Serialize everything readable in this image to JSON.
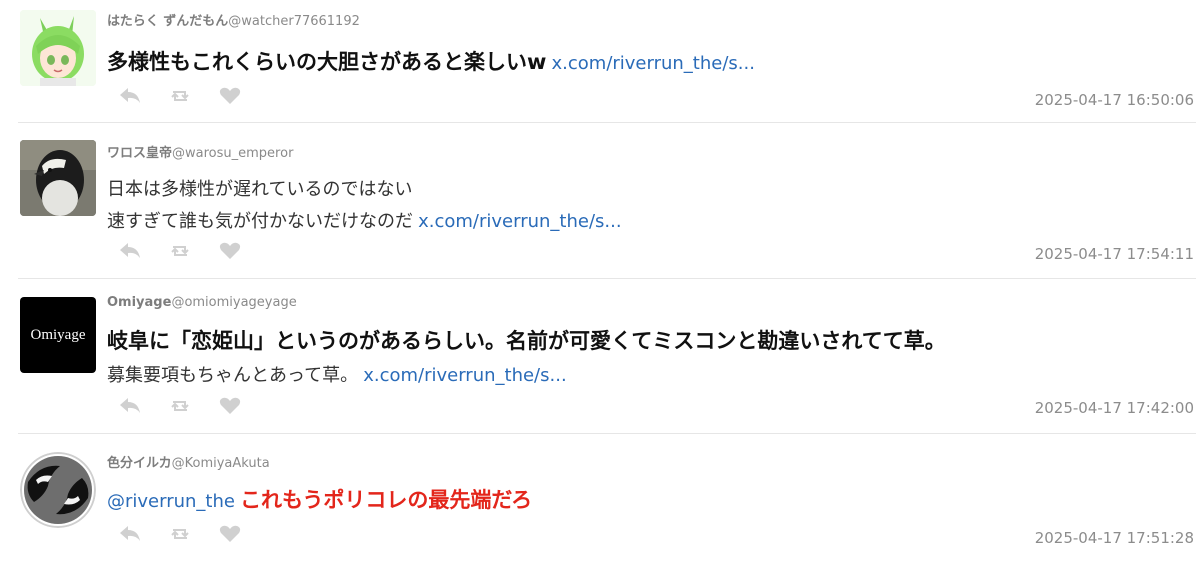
{
  "tweets": [
    {
      "display_name": "はたらく ずんだもん",
      "handle": "@watcher77661192",
      "text_line1": "多様性もこれくらいの大胆さがあると楽しいw",
      "link": "x.com/riverrun_the/s...",
      "timestamp": "2025-04-17 16:50:06"
    },
    {
      "display_name": "ワロス皇帝",
      "handle": "@warosu_emperor",
      "text_line1": "日本は多様性が遅れているのではない",
      "text_line2": "速すぎて誰も気が付かないだけなのだ",
      "link": "x.com/riverrun_the/s...",
      "timestamp": "2025-04-17 17:54:11"
    },
    {
      "display_name": "Omiyage",
      "handle": "@omiomiyageyage",
      "avatar_text": "Omiyage",
      "text_line1": "岐阜に「恋姫山」というのがあるらしい。名前が可愛くてミスコンと勘違いされてて草。",
      "text_line2": "募集要項もちゃんとあって草。",
      "link": "x.com/riverrun_the/s...",
      "timestamp": "2025-04-17 17:42:00"
    },
    {
      "display_name": "色分イルカ",
      "handle": "@KomiyaAkuta",
      "mention": "@riverrun_the",
      "text_line1": "これもうポリコレの最先端だろ",
      "timestamp": "2025-04-17 17:51:28"
    }
  ],
  "icons": {
    "reply": "reply-arrow-icon",
    "retweet": "retweet-icon",
    "like": "heart-icon"
  },
  "colors": {
    "link": "#2a6bb8",
    "highlight_red": "#e3261b",
    "icon_gray": "#d0d0d0"
  }
}
